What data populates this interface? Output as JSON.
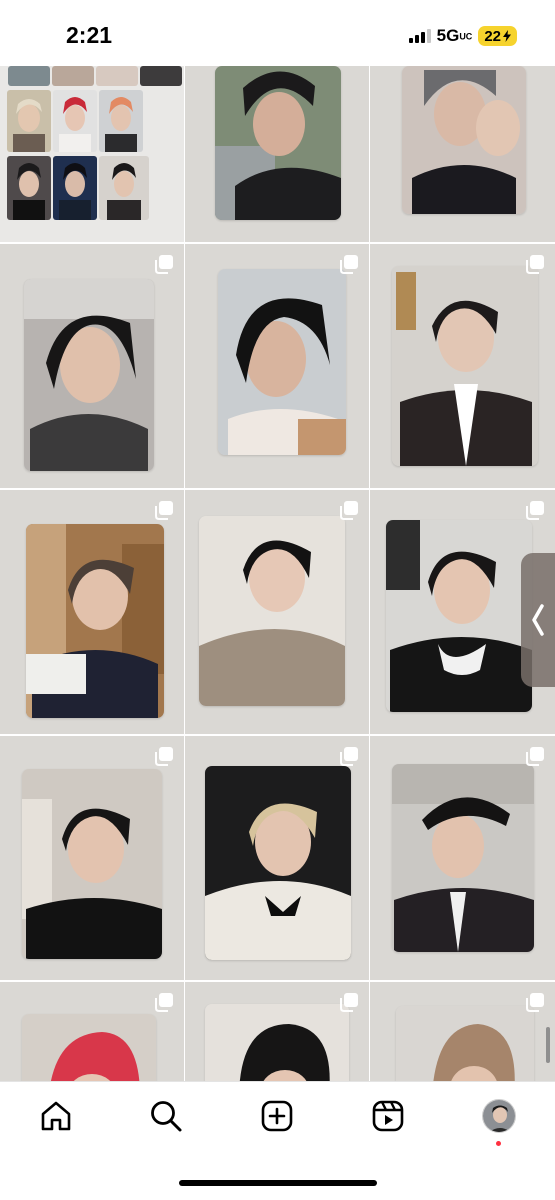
{
  "status_bar": {
    "time": "2:21",
    "network": "5G",
    "network_suffix": "UC",
    "battery_level": "22"
  },
  "grid": {
    "posts": [
      {
        "id": "post-1",
        "type": "collage"
      },
      {
        "id": "post-2",
        "type": "photocard"
      },
      {
        "id": "post-3",
        "type": "photocard"
      },
      {
        "id": "post-4",
        "type": "photocard",
        "multiple": true
      },
      {
        "id": "post-5",
        "type": "photocard",
        "multiple": true
      },
      {
        "id": "post-6",
        "type": "photocard",
        "multiple": true
      },
      {
        "id": "post-7",
        "type": "photocard",
        "multiple": true
      },
      {
        "id": "post-8",
        "type": "photocard",
        "multiple": true
      },
      {
        "id": "post-9",
        "type": "photocard",
        "multiple": true
      },
      {
        "id": "post-10",
        "type": "photocard",
        "multiple": true
      },
      {
        "id": "post-11",
        "type": "photocard",
        "multiple": true
      },
      {
        "id": "post-12",
        "type": "photocard",
        "multiple": true
      },
      {
        "id": "post-13",
        "type": "photocard",
        "multiple": true
      },
      {
        "id": "post-14",
        "type": "photocard",
        "multiple": true
      },
      {
        "id": "post-15",
        "type": "photocard",
        "multiple": true
      }
    ]
  },
  "side_tab": {
    "icon": "chevron-left-icon"
  },
  "bottom_nav": {
    "items": [
      {
        "name": "home",
        "icon": "home-icon"
      },
      {
        "name": "search",
        "icon": "search-icon"
      },
      {
        "name": "create",
        "icon": "create-post-icon"
      },
      {
        "name": "reels",
        "icon": "reels-icon"
      },
      {
        "name": "profile",
        "icon": "profile-avatar"
      }
    ]
  },
  "colors": {
    "background": "#ffffff",
    "tile_background": "#dad8d4",
    "battery": "#f6d32d",
    "notification_dot": "#ff3040"
  }
}
